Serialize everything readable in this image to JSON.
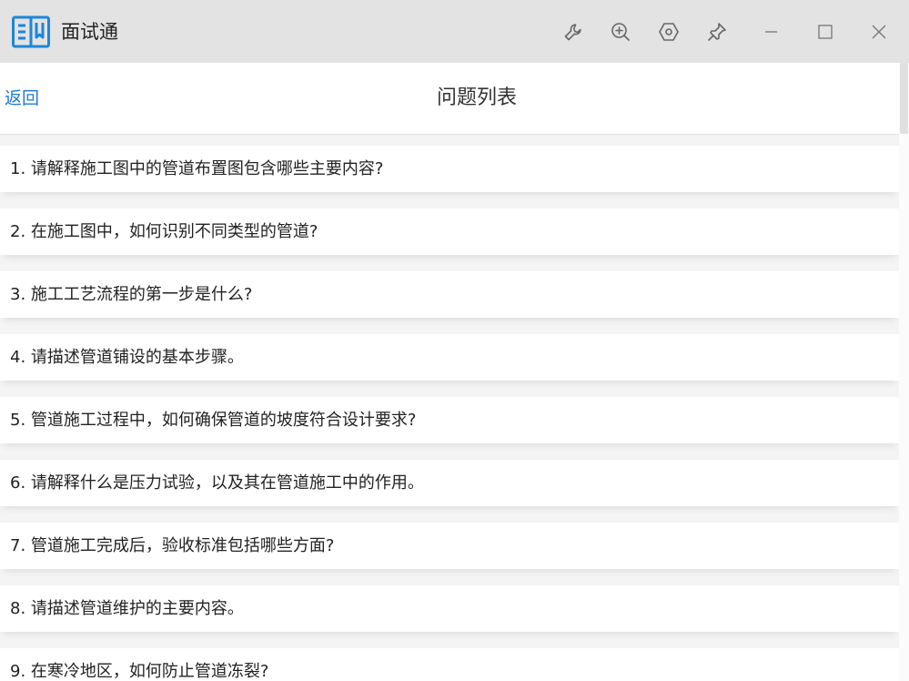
{
  "window": {
    "app_title": "面试通",
    "logo_icon": "book-icon",
    "accent_color": "#1e78d6"
  },
  "titlebar": {
    "buttons": [
      {
        "name": "wrench-icon",
        "role": "tools"
      },
      {
        "name": "zoom-in-icon",
        "role": "zoom"
      },
      {
        "name": "settings-hex-icon",
        "role": "settings"
      },
      {
        "name": "pin-icon",
        "role": "pin"
      },
      {
        "name": "minimize-icon",
        "role": "minimize"
      },
      {
        "name": "maximize-icon",
        "role": "maximize"
      },
      {
        "name": "close-icon",
        "role": "close"
      }
    ]
  },
  "header": {
    "back_label": "返回",
    "title": "问题列表"
  },
  "questions": [
    "1. 请解释施工图中的管道布置图包含哪些主要内容?",
    "2. 在施工图中，如何识别不同类型的管道?",
    "3. 施工工艺流程的第一步是什么?",
    "4. 请描述管道铺设的基本步骤。",
    "5. 管道施工过程中，如何确保管道的坡度符合设计要求?",
    "6. 请解释什么是压力试验，以及其在管道施工中的作用。",
    "7. 管道施工完成后，验收标准包括哪些方面?",
    "8. 请描述管道维护的主要内容。",
    "9. 在寒冷地区，如何防止管道冻裂?"
  ]
}
